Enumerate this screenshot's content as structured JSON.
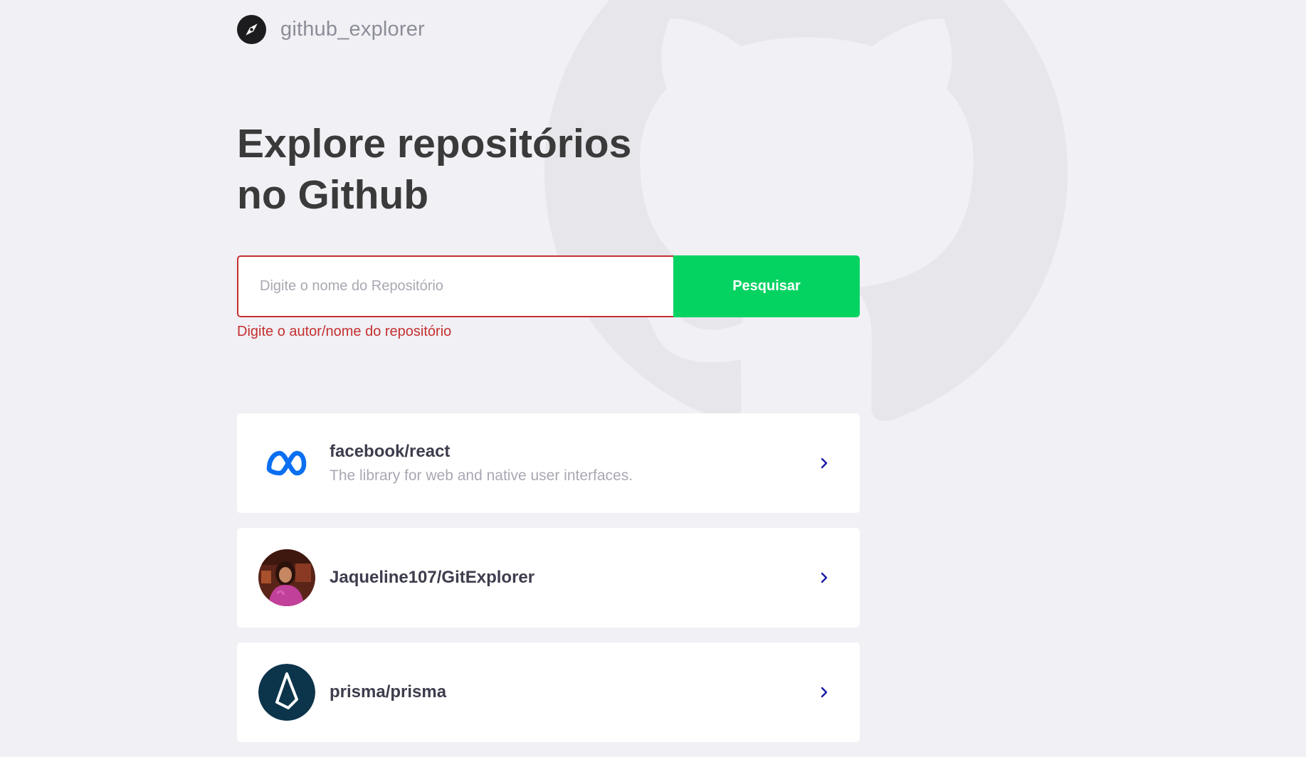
{
  "app": {
    "logo_text": "github_explorer",
    "logo_icon": "compass-icon",
    "background_icon": "octocat-icon"
  },
  "main": {
    "title_line1": "Explore repositórios",
    "title_line2": "no Github"
  },
  "search": {
    "placeholder": "Digite o nome do Repositório",
    "value": "",
    "button_label": "Pesquisar",
    "error_message": "Digite o autor/nome do repositório"
  },
  "repositories": [
    {
      "full_name": "facebook/react",
      "description": "The library for web and native user interfaces.",
      "avatar": "meta-logo-icon"
    },
    {
      "full_name": "Jaqueline107/GitExplorer",
      "description": "",
      "avatar": "user-photo-avatar"
    },
    {
      "full_name": "prisma/prisma",
      "description": "",
      "avatar": "prisma-logo-icon"
    }
  ],
  "colors": {
    "background": "#f0f0f5",
    "accent_green": "#04d361",
    "error_red": "#c53030",
    "title_text": "#3a3a3a",
    "muted_text": "#a8a8b3",
    "chevron": "#1a1aa6"
  }
}
